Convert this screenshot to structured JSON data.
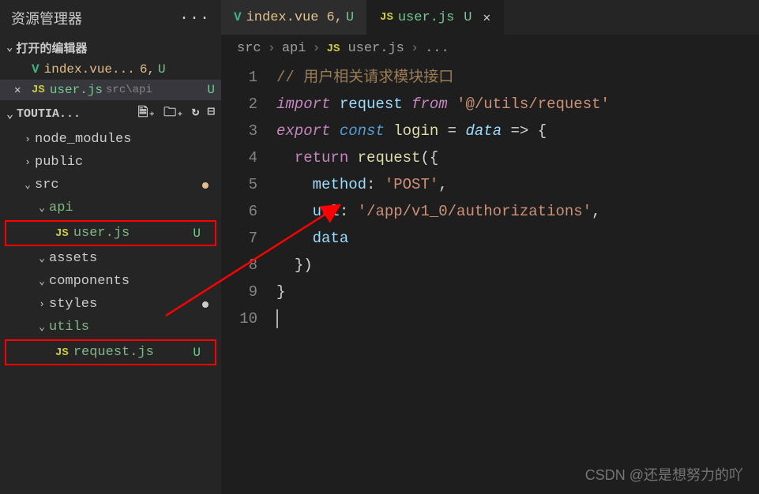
{
  "sidebar": {
    "title": "资源管理器",
    "openEditors": {
      "label": "打开的编辑器",
      "items": [
        {
          "icon": "V",
          "name": "index.vue...",
          "num": "6,",
          "status": "U"
        },
        {
          "icon": "JS",
          "name": "user.js",
          "path": "src\\api",
          "status": "U"
        }
      ]
    },
    "workspace": {
      "name": "TOUTIA...",
      "tree": [
        {
          "type": "folder",
          "name": "node_modules",
          "indent": 18,
          "chev": "›"
        },
        {
          "type": "folder",
          "name": "public",
          "indent": 18,
          "chev": "›"
        },
        {
          "type": "folder",
          "name": "src",
          "indent": 18,
          "chev": "⌄",
          "dot": "#e2c08d"
        },
        {
          "type": "folder",
          "name": "api",
          "indent": 36,
          "chev": "⌄",
          "color": "green"
        },
        {
          "type": "file",
          "name": "user.js",
          "indent": 54,
          "icon": "JS",
          "status": "U",
          "box": true,
          "color": "green"
        },
        {
          "type": "folder",
          "name": "assets",
          "indent": 36,
          "chev": "⌄"
        },
        {
          "type": "folder",
          "name": "components",
          "indent": 36,
          "chev": "⌄"
        },
        {
          "type": "folder",
          "name": "styles",
          "indent": 36,
          "chev": "›",
          "dot": "#cccccc"
        },
        {
          "type": "folder",
          "name": "utils",
          "indent": 36,
          "chev": "⌄",
          "color": "green"
        },
        {
          "type": "file",
          "name": "request.js",
          "indent": 54,
          "icon": "JS",
          "status": "U",
          "box": true,
          "color": "green"
        }
      ]
    }
  },
  "tabs": [
    {
      "icon": "V",
      "name": "index.vue",
      "num": "6,",
      "status": "U"
    },
    {
      "icon": "JS",
      "name": "user.js",
      "status": "U",
      "active": true
    }
  ],
  "breadcrumb": {
    "parts": [
      "src",
      "api"
    ],
    "fileIcon": "JS",
    "fileName": "user.js",
    "tail": "..."
  },
  "code": {
    "lines": [
      {
        "n": "1",
        "html": "<span class='c-comment'>// 用户相关请求模块接口</span>"
      },
      {
        "n": "2",
        "html": "<span class='c-keyword'>import</span> <span class='c-var2'>request</span> <span class='c-keyword'>from</span> <span class='c-string'>'@/utils/request'</span>"
      },
      {
        "n": "3",
        "html": "<span class='c-keyword'>export</span> <span class='c-const'>const</span> <span class='c-func'>login</span> <span class='c-op'>=</span> <span class='c-var'>data</span> <span class='c-op'>=&gt;</span> <span class='c-punct'>{</span>"
      },
      {
        "n": "4",
        "html": "  <span class='c-keyword2'>return</span> <span class='c-func'>request</span><span class='c-punct'>({</span>"
      },
      {
        "n": "5",
        "html": "    <span class='c-var2'>method</span><span class='c-punct'>:</span> <span class='c-string'>'POST'</span><span class='c-punct'>,</span>"
      },
      {
        "n": "6",
        "html": "    <span class='c-var2'>url</span><span class='c-punct'>:</span> <span class='c-string'>'/app/v1_0/authorizations'</span><span class='c-punct'>,</span>"
      },
      {
        "n": "7",
        "html": "    <span class='c-var2'>data</span>"
      },
      {
        "n": "8",
        "html": "  <span class='c-punct'>})</span>"
      },
      {
        "n": "9",
        "html": "<span class='c-punct'>}</span>"
      },
      {
        "n": "10",
        "html": "<span class='cursor-line'></span>"
      }
    ]
  },
  "watermark": "CSDN @还是想努力的吖"
}
